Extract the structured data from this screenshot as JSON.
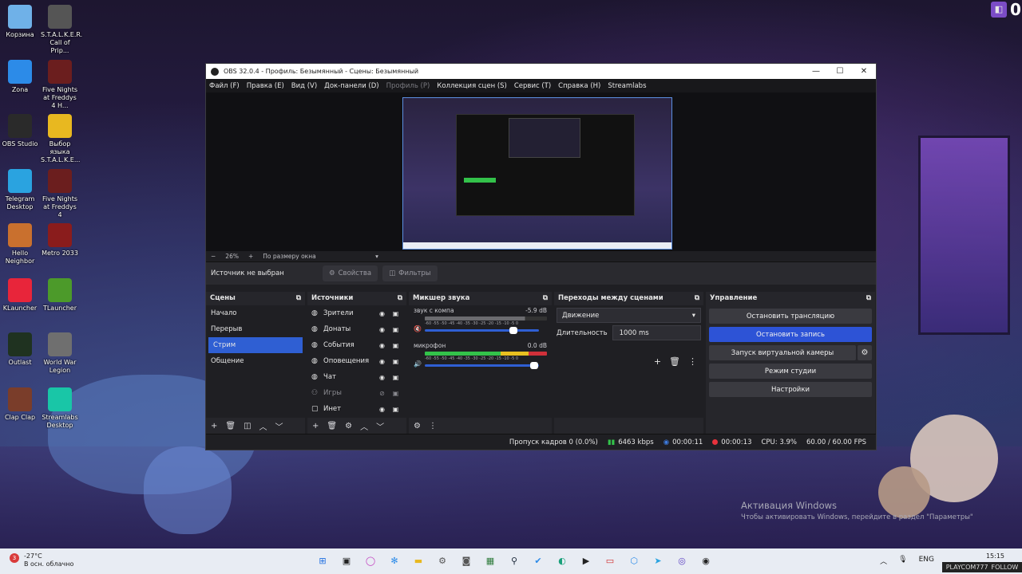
{
  "desktop": {
    "col1": [
      {
        "label": "Корзина",
        "color": "#6fb1e8"
      },
      {
        "label": "Zona",
        "color": "#2c8be8"
      },
      {
        "label": "OBS Studio",
        "color": "#2a2a2a"
      },
      {
        "label": "Telegram Desktop",
        "color": "#2aa3e0"
      },
      {
        "label": "Hello Neighbor",
        "color": "#c9702e"
      },
      {
        "label": "KLauncher",
        "color": "#e8253a"
      },
      {
        "label": "Outlast",
        "color": "#1f3220"
      },
      {
        "label": "Clap Clap",
        "color": "#7a3d2a"
      }
    ],
    "col2": [
      {
        "label": "S.T.A.L.K.E.R. Call of Prip...",
        "color": "#555555"
      },
      {
        "label": "Five Nights at Freddys 4 H...",
        "color": "#6b1e1e"
      },
      {
        "label": "Выбор языка S.T.A.L.K.E...",
        "color": "#e8b820"
      },
      {
        "label": "Five Nights at Freddys 4",
        "color": "#6b1e1e"
      },
      {
        "label": "Metro 2033",
        "color": "#8a1c1c"
      },
      {
        "label": "TLauncher",
        "color": "#4c9a2a"
      },
      {
        "label": "World War Legion",
        "color": "#6f6f6f"
      },
      {
        "label": "Streamlabs Desktop",
        "color": "#19c6a7"
      }
    ]
  },
  "window": {
    "title": "OBS 32.0.4 - Профиль: Безымянный - Сцены: Безымянный",
    "minimize": "—",
    "maximize": "☐",
    "close": "✕"
  },
  "menu": [
    {
      "label": "Файл (F)",
      "enabled": true
    },
    {
      "label": "Правка (E)",
      "enabled": true
    },
    {
      "label": "Вид (V)",
      "enabled": true
    },
    {
      "label": "Док-панели (D)",
      "enabled": true
    },
    {
      "label": "Профиль (P)",
      "enabled": false
    },
    {
      "label": "Коллекция сцен (S)",
      "enabled": true
    },
    {
      "label": "Сервис (T)",
      "enabled": true
    },
    {
      "label": "Справка (H)",
      "enabled": true
    },
    {
      "label": "Streamlabs",
      "enabled": true
    }
  ],
  "zoom": {
    "minus": "−",
    "value": "26%",
    "plus": "+",
    "fit": "По размеру окна",
    "caret": "▾"
  },
  "source_bar": {
    "no_source": "Источник не выбран",
    "properties": "Свойства",
    "filters": "Фильтры"
  },
  "scenes": {
    "title": "Сцены",
    "items": [
      "Начало",
      "Перерыв",
      "Стрим",
      "Общение"
    ],
    "active_index": 2
  },
  "sources": {
    "title": "Источники",
    "items": [
      {
        "name": "Зрители",
        "icon": "globe-icon",
        "visible": true
      },
      {
        "name": "Донаты",
        "icon": "globe-icon",
        "visible": true
      },
      {
        "name": "События",
        "icon": "globe-icon",
        "visible": true
      },
      {
        "name": "Оповещения",
        "icon": "globe-icon",
        "visible": true
      },
      {
        "name": "Чат",
        "icon": "globe-icon",
        "visible": true
      },
      {
        "name": "Игры",
        "icon": "gamepad-icon",
        "visible": false
      },
      {
        "name": "Инет",
        "icon": "monitor-icon",
        "visible": true
      }
    ]
  },
  "mixer": {
    "title": "Микшер звука",
    "channels": [
      {
        "name": "звук с компа",
        "db": "-5.9 dB",
        "level": 0.82,
        "color": "#6b6b6f",
        "muted": true
      },
      {
        "name": "микрофон",
        "db": "0.0 dB",
        "level": 1.0,
        "color": "#33c24a",
        "muted": false
      }
    ],
    "ticks": "-60 -55 -50 -45 -40 -35 -30 -25 -20 -15 -10 -5 0"
  },
  "transitions": {
    "title": "Переходы между сценами",
    "selected": "Движение",
    "duration_label": "Длительность",
    "duration_value": "1000 ms"
  },
  "controls": {
    "title": "Управление",
    "stop_stream": "Остановить трансляцию",
    "stop_record": "Остановить запись",
    "virtual_cam": "Запуск виртуальной камеры",
    "studio_mode": "Режим студии",
    "settings": "Настройки"
  },
  "status": {
    "dropped": "Пропуск кадров 0 (0.0%)",
    "bitrate": "6463 kbps",
    "stream_time": "00:00:11",
    "record_time": "00:00:13",
    "cpu": "CPU: 3.9%",
    "fps": "60.00 / 60.00 FPS"
  },
  "activation": {
    "line1": "Активация Windows",
    "line2": "Чтобы активировать Windows, перейдите в раздел \"Параметры\""
  },
  "twitch": {
    "count": "0",
    "user": "PLAYCOM777",
    "follow": "FOLLOW"
  },
  "taskbar": {
    "temp": "-27°C",
    "weather": "В осн. облачно",
    "alert": "3",
    "lang": "ENG",
    "time": "15:15"
  },
  "colors": {
    "accent": "#2f5fd3",
    "record_red": "#e8323c"
  }
}
